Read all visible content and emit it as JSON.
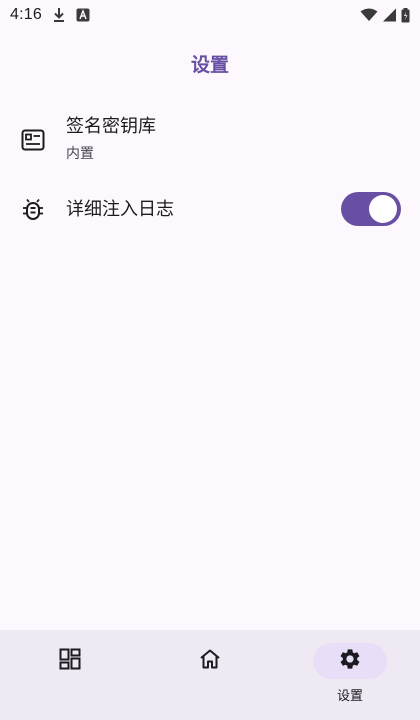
{
  "status_bar": {
    "time": "4:16",
    "icons": [
      "download-icon",
      "app-notification-icon",
      "wifi-icon",
      "signal-icon",
      "battery-icon"
    ]
  },
  "app_bar": {
    "title": "设置"
  },
  "settings": {
    "keystore": {
      "title": "签名密钥库",
      "subtitle": "内置",
      "icon": "keystore-card-icon"
    },
    "verbose_log": {
      "title": "详细注入日志",
      "icon": "bug-icon",
      "enabled": true
    }
  },
  "bottom_nav": {
    "items": [
      {
        "icon": "dashboard-icon",
        "label": ""
      },
      {
        "icon": "home-icon",
        "label": ""
      },
      {
        "icon": "gear-icon",
        "label": "设置",
        "active": true
      }
    ]
  },
  "colors": {
    "accent": "#6750a4",
    "background": "#fdf8fd",
    "nav_background": "#efe9f4",
    "nav_indicator": "#e8def8"
  }
}
